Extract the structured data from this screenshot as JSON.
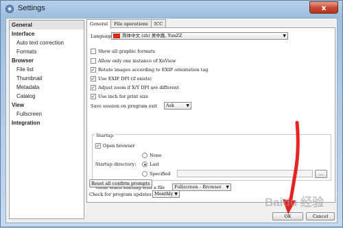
{
  "window": {
    "title": "Settings",
    "close_glyph": "x"
  },
  "sidebar": {
    "items": [
      {
        "label": "General",
        "level": "category",
        "selected": true
      },
      {
        "label": "Interface",
        "level": "category"
      },
      {
        "label": "Auto text correction",
        "level": "sub"
      },
      {
        "label": "Formats",
        "level": "sub"
      },
      {
        "label": "Browser",
        "level": "category"
      },
      {
        "label": "File list",
        "level": "sub"
      },
      {
        "label": "Thumbnail",
        "level": "sub"
      },
      {
        "label": "Metadata",
        "level": "sub"
      },
      {
        "label": "Catalog",
        "level": "sub"
      },
      {
        "label": "View",
        "level": "category"
      },
      {
        "label": "Fullscreen",
        "level": "sub"
      },
      {
        "label": "Integration",
        "level": "category"
      }
    ]
  },
  "tabs": [
    {
      "label": "General",
      "active": true
    },
    {
      "label": "File operations"
    },
    {
      "label": "ICC"
    }
  ],
  "general": {
    "language_label": "Language",
    "language_value": "简体中文 (zh) 吴中路, YunZZ",
    "options": [
      {
        "label": "Show all graphic formats",
        "checked": false
      },
      {
        "label": "Allow only one instance of XnView",
        "checked": false
      },
      {
        "label": "Rotate images according to EXIF orientation tag",
        "checked": true
      },
      {
        "label": "Use EXIF DPI (if exists)",
        "checked": true
      },
      {
        "label": "Adjust zoom if X/Y DPI are different",
        "checked": true
      },
      {
        "label": "Use inch for print size",
        "checked": true
      }
    ],
    "save_session_label": "Save session on program exit",
    "save_session_value": "Ask",
    "startup": {
      "group_label": "Startup",
      "open_browser_label": "Open browser",
      "open_browser_checked": true,
      "startup_dir_label": "Startup directory:",
      "radios": [
        {
          "label": "None",
          "selected": false
        },
        {
          "label": "Last",
          "selected": true
        },
        {
          "label": "Specified",
          "selected": false
        }
      ],
      "specified_path": "",
      "browse_button": "...",
      "mode_label": "Mode when starting with a file",
      "mode_value": "Fullscreen - Browser"
    },
    "reset_button": "Reset all confirm prompts",
    "updates_label": "Check for program updates",
    "updates_value": "Monthly"
  },
  "footer": {
    "ok_button": "OK",
    "cancel_button": "Cancel"
  },
  "colors": {
    "annotation_arrow": "#e8231f",
    "selection_radio": "#2a62b8",
    "flag": "#d62a1d"
  },
  "watermark": "Baidu 经验"
}
